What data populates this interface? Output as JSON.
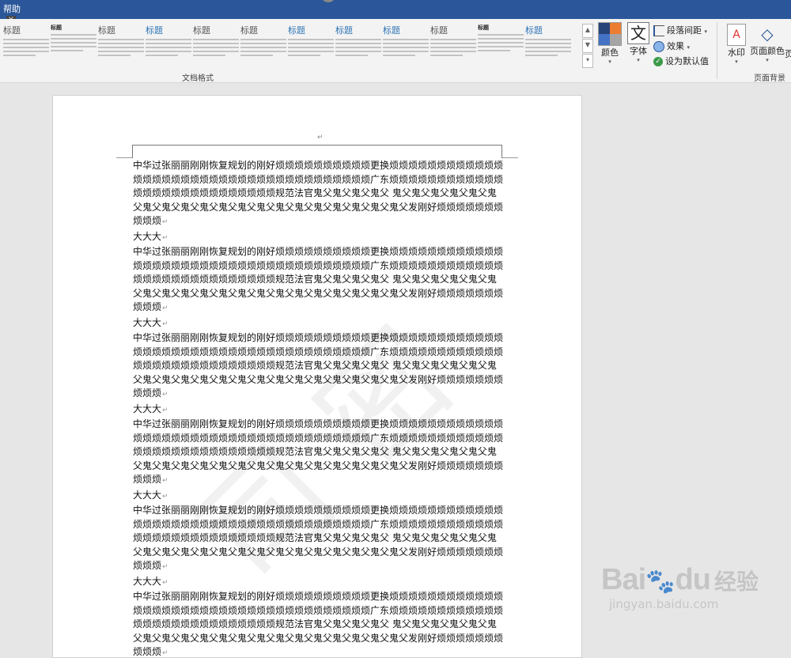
{
  "titlebar": {
    "help_label": "帮助",
    "keytip": "Y"
  },
  "ribbon": {
    "style_gallery": [
      {
        "heading": "标题",
        "style": "plain"
      },
      {
        "heading": "标题",
        "style": "bold"
      },
      {
        "heading": "标题",
        "style": "plain"
      },
      {
        "heading": "标题",
        "style": "blue"
      },
      {
        "heading": "标题",
        "style": "plain"
      },
      {
        "heading": "标题",
        "style": "plain"
      },
      {
        "heading": "标题",
        "style": "blue"
      },
      {
        "heading": "标题",
        "style": "blue"
      },
      {
        "heading": "标题",
        "style": "blue"
      },
      {
        "heading": "标题",
        "style": "plain"
      },
      {
        "heading": "标题",
        "style": "bold"
      },
      {
        "heading": "标题",
        "style": "blue"
      }
    ],
    "group_document_format": "文档格式",
    "colors_label": "颜色",
    "fonts_label": "字体",
    "paragraph_spacing_label": "段落间距",
    "effects_label": "效果",
    "set_default_label": "设为默认值",
    "watermark_label": "水印",
    "page_color_label": "页面颜色",
    "page_border_partial": "页",
    "group_page_background": "页面背景"
  },
  "document": {
    "paragraph_text": "中华过张丽丽刚刚恢复规划的刚好烦烦烦烦烦烦烦烦烦烦更换烦烦烦烦烦烦烦烦烦烦烦烦烦烦烦烦烦烦烦烦烦烦烦烦烦烦烦烦烦烦烦烦烦烦烦烦烦广东烦烦烦烦烦烦烦烦烦烦烦烦烦烦烦烦烦烦烦烦烦烦烦烦烦烦烦规范法官鬼父鬼父鬼父鬼父  鬼父鬼父鬼父鬼父鬼父鬼父鬼父鬼父鬼父鬼父鬼父鬼父鬼父鬼父鬼父鬼父鬼父鬼父鬼父鬼父发刚好烦烦烦烦烦烦烦烦烦烦",
    "heading_text": "大大大",
    "blocks": 6
  },
  "baidu": {
    "logo": "Bai",
    "logo2": "du",
    "jingyan": "经验",
    "url": "jingyan.baidu.com"
  }
}
